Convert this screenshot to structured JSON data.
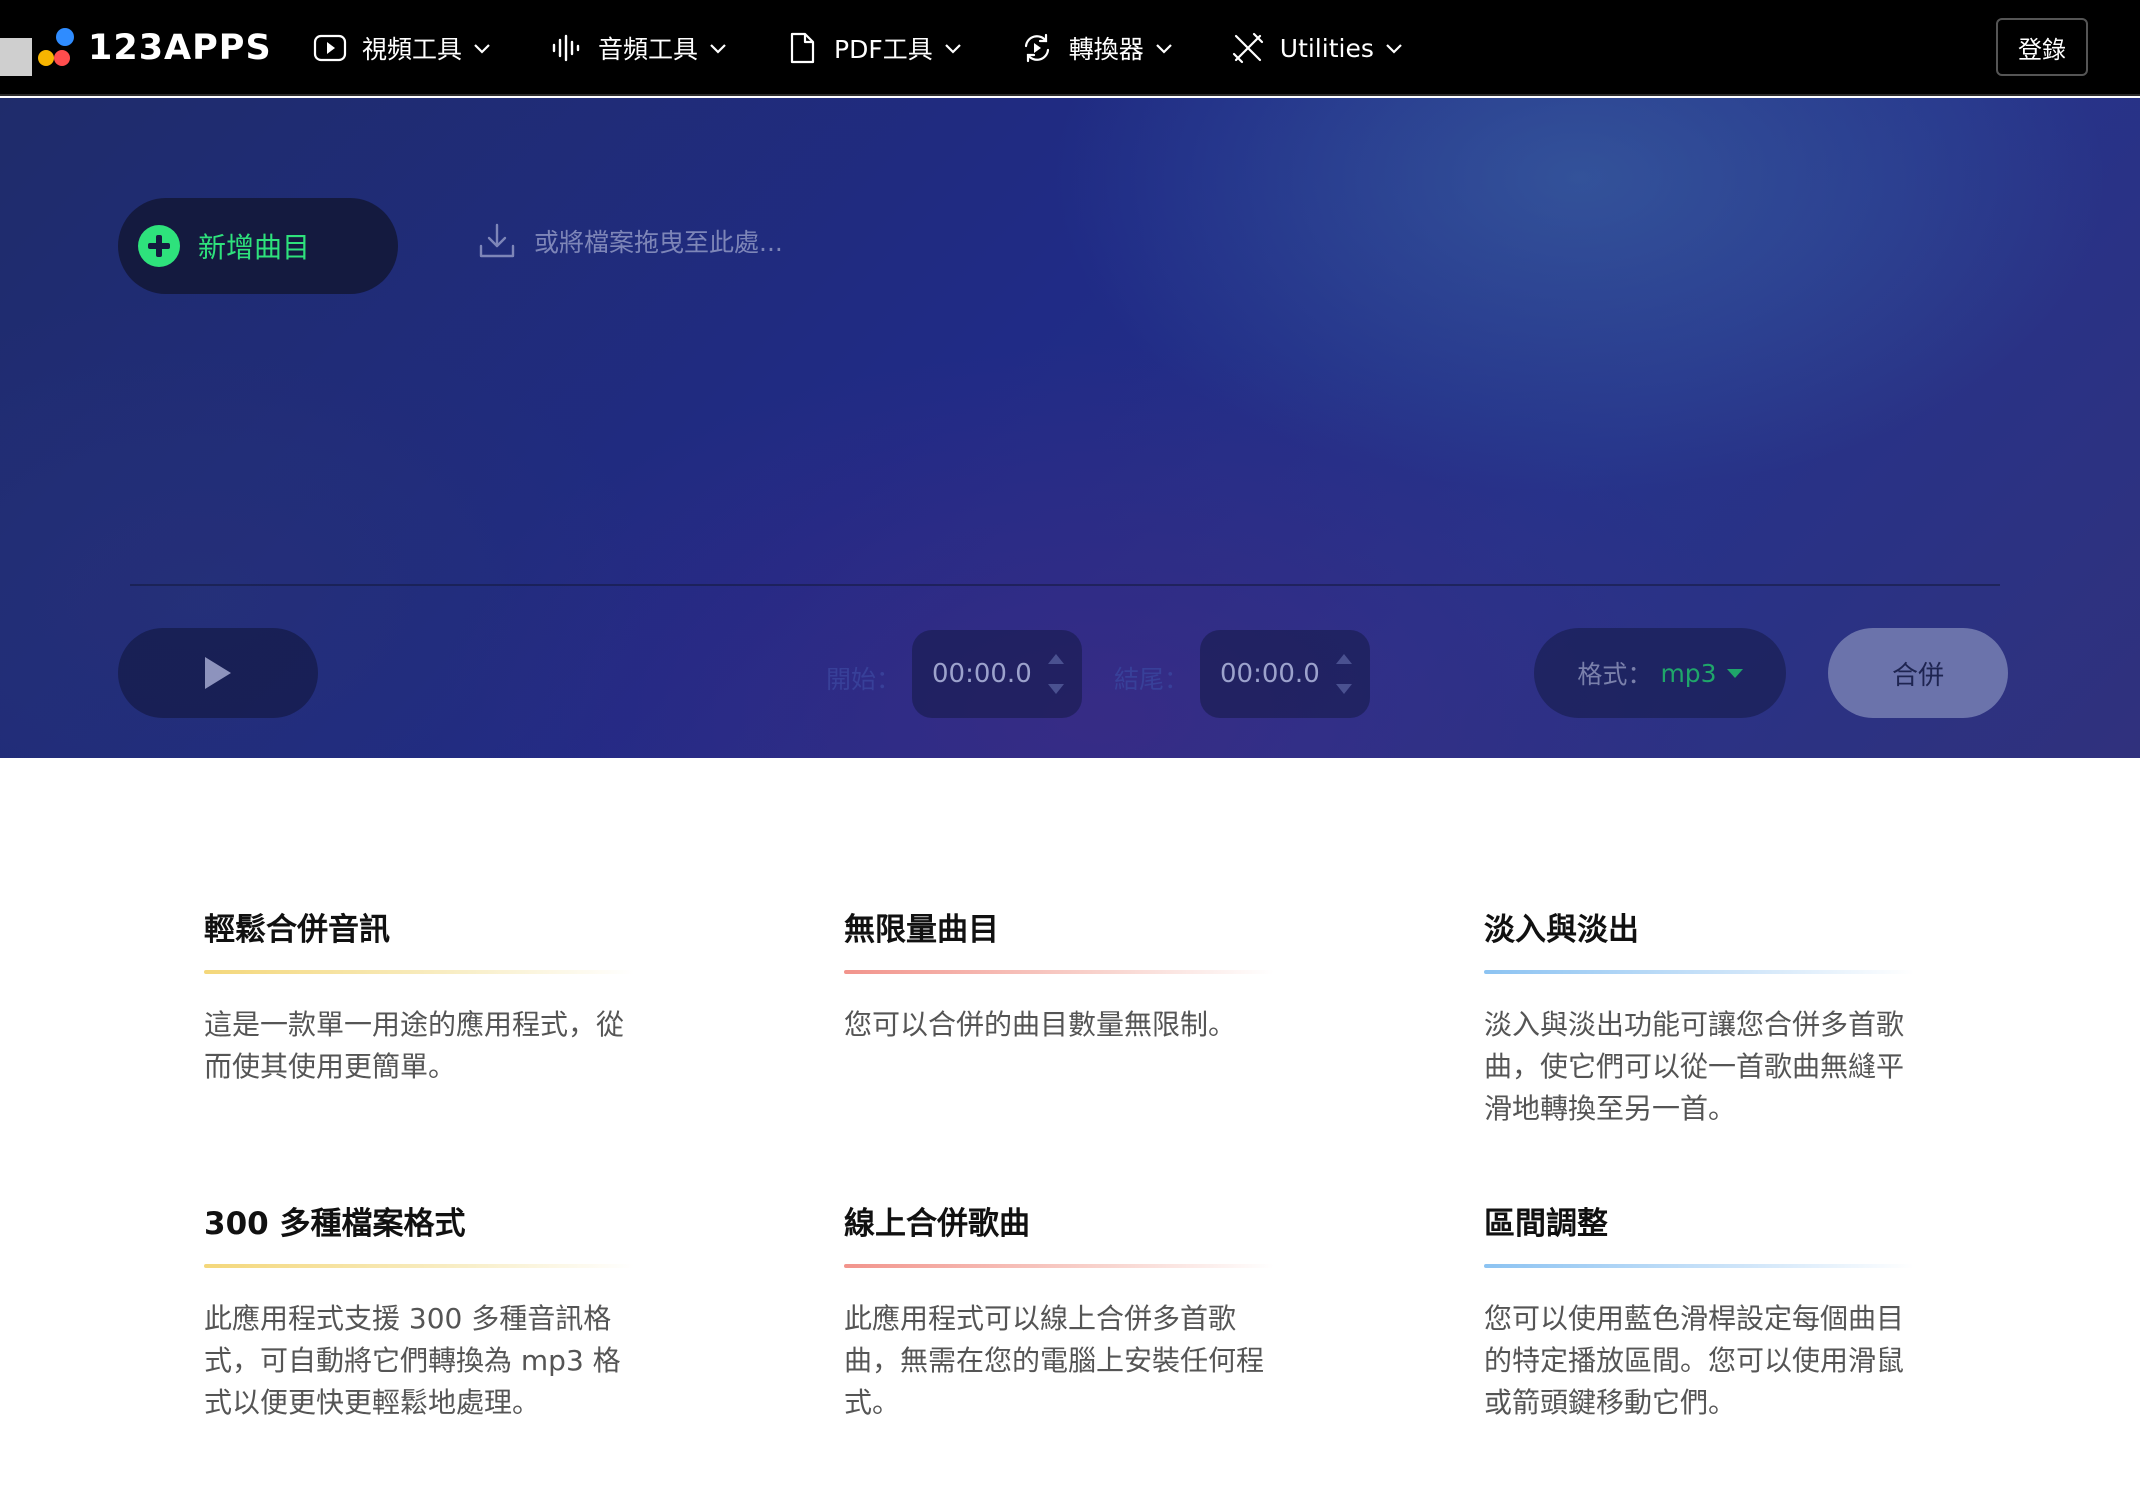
{
  "brand": {
    "name": "123APPS",
    "dot_colors": [
      "#f7b500",
      "#ff4d4d",
      "#2f8cff"
    ]
  },
  "nav": {
    "items": [
      {
        "label": "視頻工具",
        "icon": "video-play-icon"
      },
      {
        "label": "音頻工具",
        "icon": "audio-wave-icon"
      },
      {
        "label": "PDF工具",
        "icon": "document-icon"
      },
      {
        "label": "轉換器",
        "icon": "convert-cycle-icon"
      },
      {
        "label": "Utilities",
        "icon": "tools-icon"
      }
    ],
    "login_label": "登錄"
  },
  "app": {
    "add_track_label": "新增曲目",
    "drop_hint": "或將檔案拖曳至此處...",
    "start_label": "開始：",
    "start_value": "00:00.0",
    "end_label": "結尾：",
    "end_value": "00:00.0",
    "format_label": "格式：",
    "format_value": "mp3",
    "merge_label": "合併",
    "colors": {
      "accent": "#2ee27c",
      "merge_button": "#6b73ab"
    }
  },
  "features": [
    {
      "title": "輕鬆合併音訊",
      "text": "這是一款單一用途的應用程式，從而使其使用更簡單。",
      "accent": "yellow"
    },
    {
      "title": "無限量曲目",
      "text": "您可以合併的曲目數量無限制。",
      "accent": "red"
    },
    {
      "title": "淡入與淡出",
      "text": "淡入與淡出功能可讓您合併多首歌曲，使它們可以從一首歌曲無縫平滑地轉換至另一首。",
      "accent": "blue"
    },
    {
      "title": "300 多種檔案格式",
      "text": "此應用程式支援 300 多種音訊格式，可自動將它們轉換為 mp3 格式以便更快更輕鬆地處理。",
      "accent": "yellow"
    },
    {
      "title": "線上合併歌曲",
      "text": "此應用程式可以線上合併多首歌曲，無需在您的電腦上安裝任何程式。",
      "accent": "red"
    },
    {
      "title": "區間調整",
      "text": "您可以使用藍色滑桿設定每個曲目的特定播放區間。您可以使用滑鼠或箭頭鍵移動它們。",
      "accent": "blue"
    }
  ]
}
